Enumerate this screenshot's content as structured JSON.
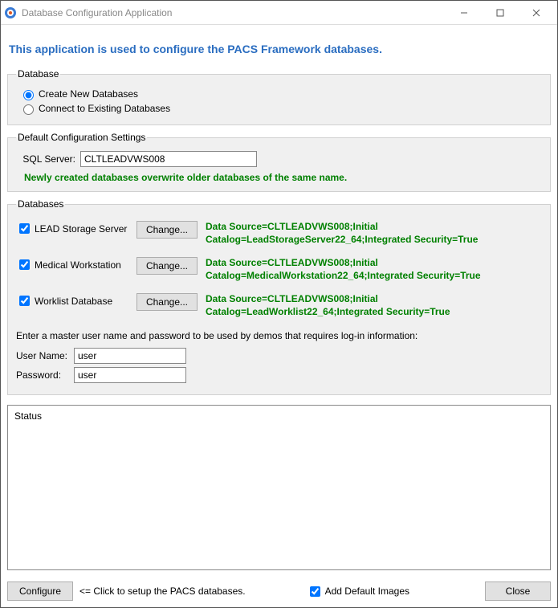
{
  "window": {
    "title": "Database Configuration Application"
  },
  "banner": "This application is used to configure the PACS Framework databases.",
  "database_group": {
    "legend": "Database",
    "create_label": "Create New Databases",
    "connect_label": "Connect to Existing Databases"
  },
  "config_group": {
    "legend": "Default Configuration Settings",
    "sql_label": "SQL Server:",
    "sql_value": "CLTLEADVWS008",
    "warning": "Newly created databases overwrite older databases of the same name."
  },
  "databases_group": {
    "legend": "Databases",
    "change_label": "Change...",
    "items": [
      {
        "label": "LEAD Storage Server",
        "ds": "Data Source=CLTLEADVWS008;Initial Catalog=LeadStorageServer22_64;Integrated Security=True"
      },
      {
        "label": "Medical Workstation",
        "ds": "Data Source=CLTLEADVWS008;Initial Catalog=MedicalWorkstation22_64;Integrated Security=True"
      },
      {
        "label": "Worklist Database",
        "ds": "Data Source=CLTLEADVWS008;Initial Catalog=LeadWorklist22_64;Integrated Security=True"
      }
    ],
    "prompt": "Enter a master user name and password to be used by demos that requires log-in information:",
    "user_label": "User Name:",
    "user_value": "user",
    "pass_label": "Password:",
    "pass_value": "user"
  },
  "status": {
    "label": "Status"
  },
  "bottom": {
    "configure": "Configure",
    "hint": "<= Click to setup the PACS databases.",
    "add_default": "Add Default Images",
    "close": "Close"
  }
}
